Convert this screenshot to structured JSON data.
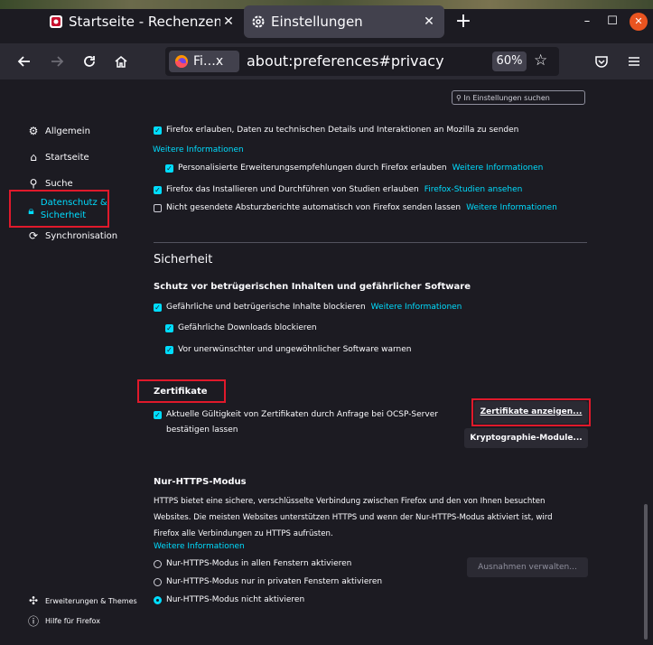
{
  "tabs": [
    {
      "title": "Startseite - Rechenzentrum",
      "close": "✕"
    },
    {
      "title": "Einstellungen",
      "close": "✕"
    }
  ],
  "new_tab": "+",
  "window_controls": {
    "minimize": "–",
    "maximize": "☐",
    "close": "✕"
  },
  "urlbar": {
    "identity": "Fi…x",
    "url": "about:preferences#privacy",
    "zoom": "60%"
  },
  "search": {
    "placeholder": "In Einstellungen suchen"
  },
  "sidebar": {
    "items": [
      {
        "label": "Allgemein",
        "icon": "gear-icon"
      },
      {
        "label": "Startseite",
        "icon": "home-icon"
      },
      {
        "label": "Suche",
        "icon": "search-icon"
      },
      {
        "label": "Datenschutz & Sicherheit",
        "icon": "lock-icon"
      },
      {
        "label": "Synchronisation",
        "icon": "sync-icon"
      }
    ],
    "footer": [
      {
        "label": "Erweiterungen & Themes",
        "icon": "puzzle-icon"
      },
      {
        "label": "Hilfe für Firefox",
        "icon": "help-icon"
      }
    ]
  },
  "data_collection": {
    "allow_technical": "Firefox erlauben, Daten zu technischen Details und Interaktionen an Mozilla zu senden",
    "more_info": "Weitere Informationen",
    "personalized": "Personalisierte Erweiterungsempfehlungen durch Firefox erlauben",
    "studies": "Firefox das Installieren und Durchführen von Studien erlauben",
    "studies_link": "Firefox-Studien ansehen",
    "crash_reports": "Nicht gesendete Absturzberichte automatisch von Firefox senden lassen"
  },
  "security": {
    "heading": "Sicherheit",
    "subheading": "Schutz vor betrügerischen Inhalten und gefährlicher Software",
    "block_dangerous": "Gefährliche und betrügerische Inhalte blockieren",
    "block_downloads": "Gefährliche Downloads blockieren",
    "warn_software": "Vor unerwünschter und ungewöhnlicher Software warnen"
  },
  "certificates": {
    "heading": "Zertifikate",
    "ocsp_line1": "Aktuelle Gültigkeit von Zertifikaten durch Anfrage bei OCSP-Server",
    "ocsp_line2": "bestätigen lassen",
    "view_button": "Zertifikate anzeigen...",
    "crypto_button": "Kryptographie-Module..."
  },
  "https_only": {
    "heading": "Nur-HTTPS-Modus",
    "desc1": "HTTPS bietet eine sichere, verschlüsselte Verbindung zwischen Firefox und den von Ihnen besuchten",
    "desc2": "Websites. Die meisten Websites unterstützen HTTPS und wenn der Nur-HTTPS-Modus aktiviert ist, wird",
    "desc3": "Firefox alle Verbindungen zu HTTPS aufrüsten.",
    "more_info": "Weitere Informationen",
    "opt_all": "Nur-HTTPS-Modus in allen Fenstern aktivieren",
    "opt_private": "Nur-HTTPS-Modus nur in privaten Fenstern aktivieren",
    "opt_off": "Nur-HTTPS-Modus nicht aktivieren",
    "exceptions_button": "Ausnahmen verwalten..."
  },
  "colors": {
    "accent": "#00ddff",
    "highlight": "#e0192b",
    "background": "#1c1b22"
  }
}
